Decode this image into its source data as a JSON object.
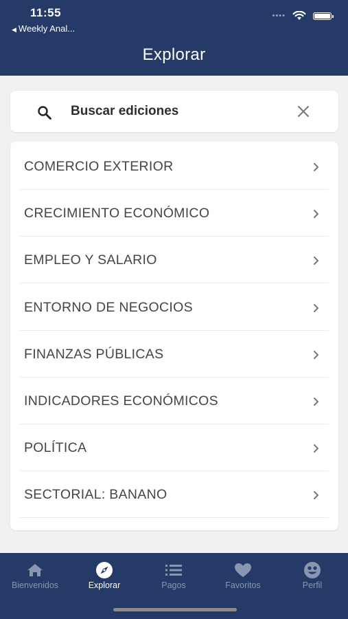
{
  "status_bar": {
    "time": "11:55",
    "back_label": "Weekly Anal..."
  },
  "header": {
    "title": "Explorar"
  },
  "search": {
    "placeholder": "Buscar ediciones"
  },
  "categories": [
    {
      "label": "COMERCIO EXTERIOR"
    },
    {
      "label": "CRECIMIENTO ECONÓMICO"
    },
    {
      "label": "EMPLEO Y SALARIO"
    },
    {
      "label": "ENTORNO DE NEGOCIOS"
    },
    {
      "label": "FINANZAS PÚBLICAS"
    },
    {
      "label": "INDICADORES ECONÓMICOS"
    },
    {
      "label": "POLÍTICA"
    },
    {
      "label": "SECTORIAL: BANANO"
    }
  ],
  "tabs": [
    {
      "label": "Bienvenidos",
      "icon": "home-icon",
      "active": false
    },
    {
      "label": "Explorar",
      "icon": "compass-icon",
      "active": true
    },
    {
      "label": "Pagos",
      "icon": "list-icon",
      "active": false
    },
    {
      "label": "Favoritos",
      "icon": "heart-icon",
      "active": false
    },
    {
      "label": "Perfil",
      "icon": "profile-icon",
      "active": false
    }
  ],
  "colors": {
    "primary": "#253a67",
    "background": "#f1f1f2",
    "tab_inactive": "#8a96b0"
  }
}
